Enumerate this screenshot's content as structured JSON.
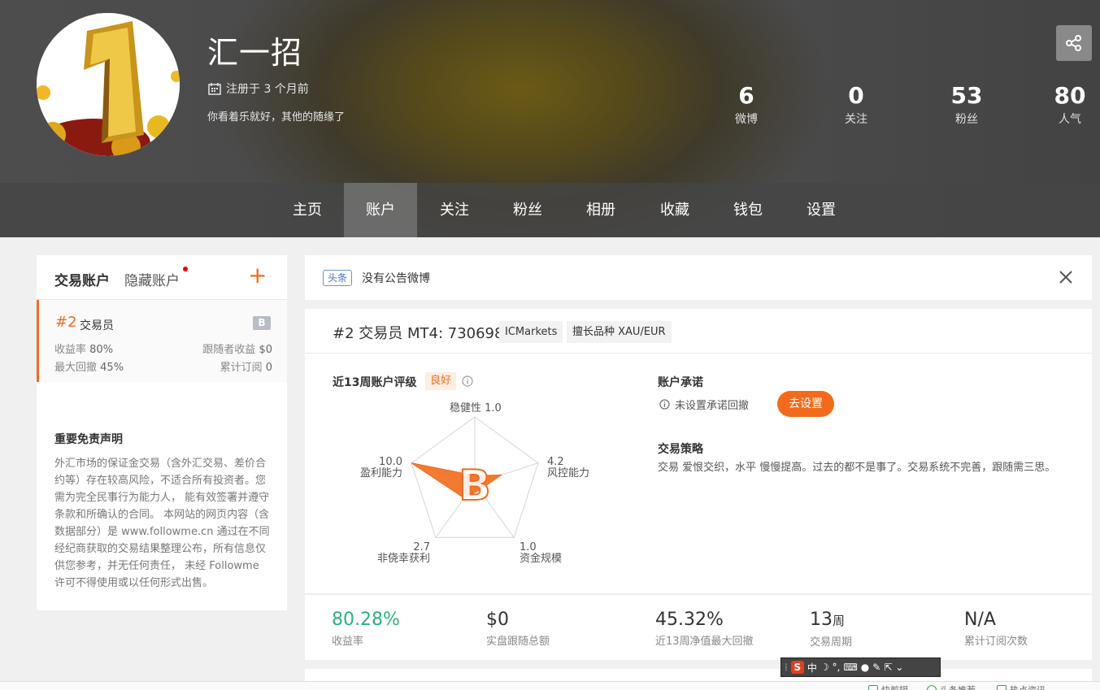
{
  "profile": {
    "username": "汇一招",
    "registered": "注册于 3 个月前",
    "bio": "你看着乐就好，其他的随缘了"
  },
  "stats": [
    {
      "value": "6",
      "label": "微博"
    },
    {
      "value": "0",
      "label": "关注"
    },
    {
      "value": "53",
      "label": "粉丝"
    },
    {
      "value": "80",
      "label": "人气"
    }
  ],
  "nav": [
    "主页",
    "账户",
    "关注",
    "粉丝",
    "相册",
    "收藏",
    "钱包",
    "设置"
  ],
  "nav_active": "账户",
  "left_panel": {
    "tab_main": "交易账户",
    "tab_hidden": "隐藏账户",
    "add": "+",
    "account": {
      "num": "#2",
      "role": "交易员",
      "badge": "B",
      "return_label": "收益率",
      "return_value": "80%",
      "follower_profit_label": "跟随者收益",
      "follower_profit_value": "$0",
      "drawdown_label": "最大回撤",
      "drawdown_value": "45%",
      "subs_label": "累计订阅",
      "subs_value": "0"
    },
    "disclaimer_title": "重要免责声明",
    "disclaimer_text": "外汇市场的保证金交易（含外汇交易、差价合约等）存在较高风险，不适合所有投资者。您需为完全民事行为能力人， 能有效签署并遵守条款和所确认的合同。 本网站的网页内容（含数据部分）是 www.followme.cn 通过在不同经纪商获取的交易结果整理公布，所有信息仅供您参考，并无任何责任， 未经 Followme 许可不得使用或以任何形式出售。"
  },
  "notice": {
    "tag": "头条",
    "text": "没有公告微博"
  },
  "account_card": {
    "title": "#2 交易员 MT4: 730698",
    "broker": "ICMarkets",
    "specialty": "擅长品种 XAU/EUR",
    "rating_label": "近13周账户评级",
    "rating_value": "良好",
    "grade": "B",
    "radar": [
      {
        "name": "稳健性",
        "value": "1.0"
      },
      {
        "name": "风控能力",
        "value": "4.2"
      },
      {
        "name": "资金规模",
        "value": "1.0"
      },
      {
        "name": "非侥幸获利",
        "value": "2.7"
      },
      {
        "name": "盈利能力",
        "value": "10.0"
      }
    ],
    "promise_title": "账户承诺",
    "promise_text": "未设置承诺回撤",
    "promise_button": "去设置",
    "strategy_title": "交易策略",
    "strategy_text": "交易 爱恨交织，水平 慢慢提高。过去的都不是事了。交易系统不完善，跟随需三思。"
  },
  "bottom_stats": [
    {
      "value": "80.28%",
      "label": "收益率"
    },
    {
      "value": "$0",
      "label": "实盘跟随总额"
    },
    {
      "value": "45.32%",
      "label": "近13周净值最大回撤"
    },
    {
      "value": "13",
      "unit": "周",
      "label": "交易周期"
    },
    {
      "value": "N/A",
      "label": "累计订阅次数"
    }
  ],
  "ime": {
    "mode": "中"
  },
  "taskbar": [
    "快剪辑",
    "头条推荐",
    "热点资讯"
  ],
  "colors": {
    "accent": "#f26b1d",
    "green": "#2ab27b",
    "tag_blue": "#4a6fc2"
  }
}
